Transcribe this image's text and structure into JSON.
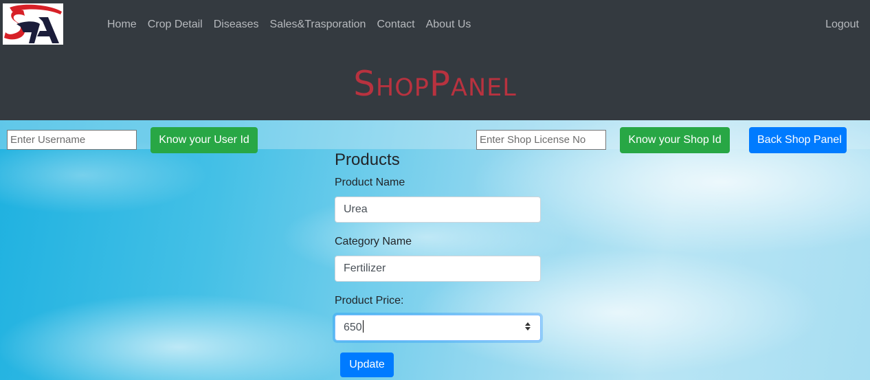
{
  "nav": {
    "links": [
      "Home",
      "Crop Detail",
      "Diseases",
      "Sales&Trasporation",
      "Contact",
      "About Us"
    ],
    "logout": "Logout"
  },
  "brand": "ShopPanel",
  "toolbar": {
    "username_placeholder": "Enter Username",
    "user_id_button": "Know your User Id",
    "license_placeholder": "Enter Shop License No",
    "shop_id_button": "Know your Shop Id",
    "back_button": "Back Shop Panel"
  },
  "form": {
    "title": "Products",
    "product_name_label": "Product Name",
    "product_name_value": "Urea",
    "category_label": "Category Name",
    "category_value": "Fertilizer",
    "price_label": "Product Price:",
    "price_value": "650",
    "update_button": "Update"
  },
  "colors": {
    "navbar": "#343a40",
    "brand": "#b8323f",
    "green": "#28a745",
    "blue": "#007bff"
  }
}
